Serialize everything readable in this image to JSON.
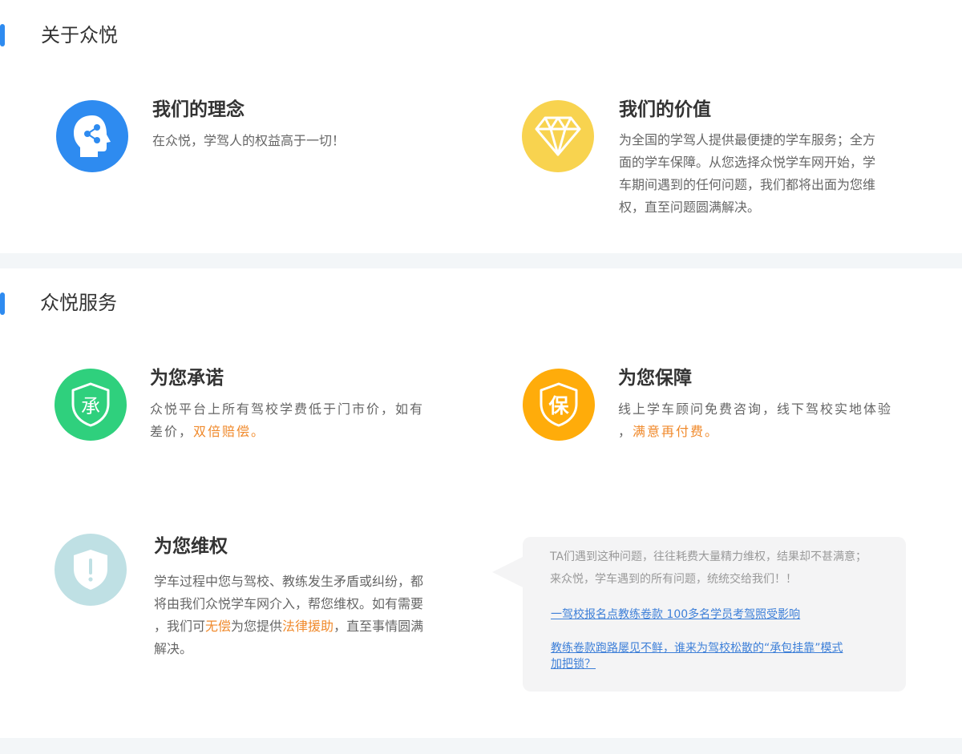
{
  "about": {
    "title": "关于众悦",
    "concept": {
      "title": "我们的理念",
      "text": "在众悦，学驾人的权益高于一切！",
      "icon": "head-network-icon",
      "color": "#2e8bf0"
    },
    "value": {
      "title": "我们的价值",
      "lines": [
        "为全国的学驾人提供最便捷的学车服务；全方",
        "面的学车保障。从您选择众悦学车网开始，学",
        "车期间遇到的任何问题，我们都将出面为您维",
        "权，直至问题圆满解决。"
      ],
      "icon": "diamond-icon",
      "color": "#f8d34f"
    }
  },
  "services": {
    "title": "众悦服务",
    "promise": {
      "title": "为您承诺",
      "line1": "众悦平台上所有驾校学费低于门市价，如有",
      "line2_pre": "差价，",
      "line2_hl": "双倍赔偿。",
      "icon": "shield-cheng-icon",
      "icon_char": "承",
      "color": "#2fd07d"
    },
    "guarantee": {
      "title": "为您保障",
      "line1": "线上学车顾问免费咨询，线下驾校实地体验",
      "line2_pre": "，",
      "line2_hl": "满意再付费。",
      "icon": "shield-bao-icon",
      "icon_char": "保",
      "color": "#ffac0a"
    },
    "rights": {
      "title": "为您维权",
      "line1": "学车过程中您与驾校、教练发生矛盾或纠纷，都",
      "line2": "将由我们众悦学车网介入，帮您维权。如有需要",
      "line3_a": "，我们可",
      "line3_hl1": "无偿",
      "line3_b": "为您提供",
      "line3_hl2": "法律援助",
      "line3_c": "，直至事情圆满",
      "line4": "解决。",
      "icon": "shield-exclaim-icon",
      "color": "#bfe0e4"
    },
    "bubble": {
      "line1": "TA们遇到这种问题，往往耗费大量精力维权，结果却不甚满意；",
      "line2": "来众悦，学车遇到的所有问题，统统交给我们！！",
      "link1": "一驾校报名点教练卷款 100多名学员考驾照受影响",
      "link2_line1": "教练卷款跑路屡见不鲜，谁来为驾校松散的“承包挂靠”模式",
      "link2_line2": "加把锁？"
    }
  }
}
